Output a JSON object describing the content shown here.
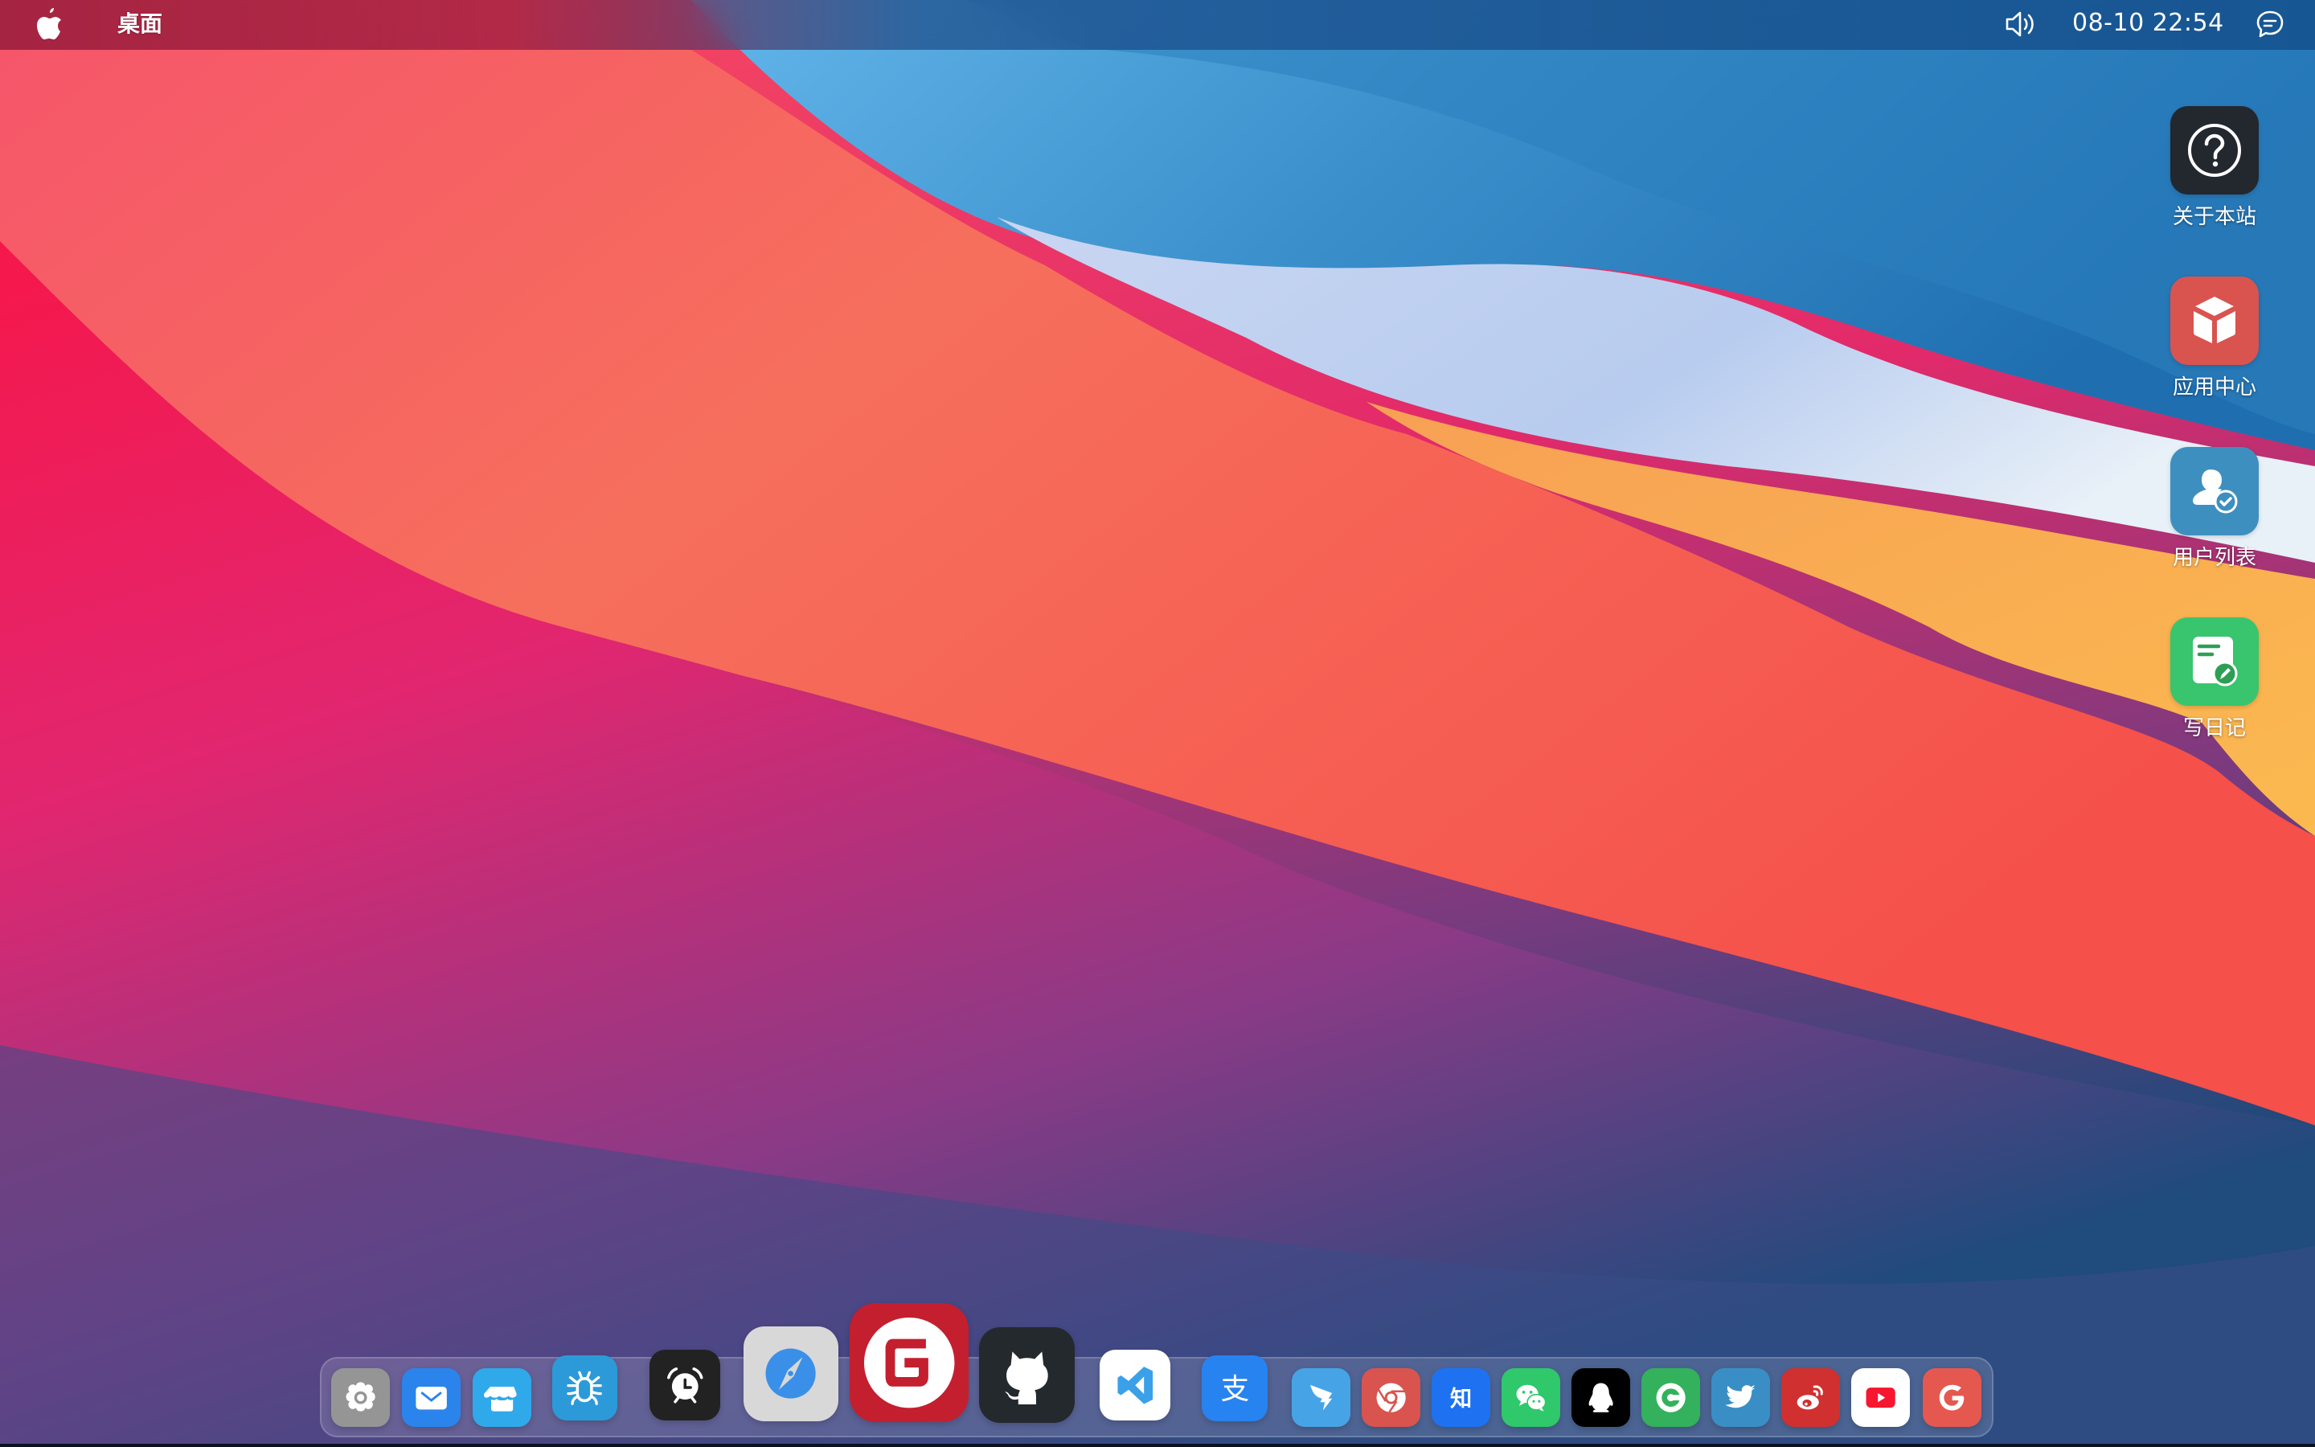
{
  "menubar": {
    "apple_icon": "apple-logo-icon",
    "title": "桌面",
    "volume_icon": "volume-icon",
    "clock": "08-10 22:54",
    "message_icon": "chat-bubble-icon"
  },
  "desktop_icons": [
    {
      "label": "关于本站",
      "icon": "help-circle-icon",
      "color": "#23272e"
    },
    {
      "label": "应用中心",
      "icon": "box-icon",
      "color": "#d9534f"
    },
    {
      "label": "用户列表",
      "icon": "user-check-icon",
      "color": "#3d8fc0"
    },
    {
      "label": "写日记",
      "icon": "note-edit-icon",
      "color": "#38c56d"
    }
  ],
  "dock": {
    "items": [
      {
        "name": "settings",
        "icon": "gear-icon",
        "color": "#959595"
      },
      {
        "name": "mail",
        "icon": "mail-icon",
        "color": "#2b84ec"
      },
      {
        "name": "app-store",
        "icon": "store-icon",
        "color": "#2fa9ea"
      },
      {
        "name": "bug",
        "icon": "bug-icon",
        "color": "#2c9ad8"
      },
      {
        "name": "alarm",
        "icon": "alarm-clock-icon",
        "color": "#222222"
      },
      {
        "name": "safari",
        "icon": "compass-icon",
        "color": "#d8d8d8"
      },
      {
        "name": "gitee",
        "icon": "gitee-icon",
        "color": "#c41f2f"
      },
      {
        "name": "github",
        "icon": "github-icon",
        "color": "#24292e"
      },
      {
        "name": "vscode",
        "icon": "vscode-icon",
        "color": "#ffffff"
      },
      {
        "name": "alipay",
        "icon": "alipay-icon",
        "color": "#2783f0"
      },
      {
        "name": "dingtalk",
        "icon": "dingtalk-icon",
        "color": "#46a4e6"
      },
      {
        "name": "chrome",
        "icon": "chrome-icon",
        "color": "#d9534f"
      },
      {
        "name": "zhihu",
        "icon": "zhihu-icon",
        "color": "#1e72f2",
        "glyph": "知"
      },
      {
        "name": "wechat",
        "icon": "wechat-icon",
        "color": "#2fc86b"
      },
      {
        "name": "qq",
        "icon": "qq-penguin-icon",
        "color": "#000000"
      },
      {
        "name": "copyright",
        "icon": "copyright-c-icon",
        "color": "#33b15c"
      },
      {
        "name": "twitter",
        "icon": "twitter-bird-icon",
        "color": "#3a8ec6"
      },
      {
        "name": "weibo",
        "icon": "weibo-icon",
        "color": "#d0302f"
      },
      {
        "name": "youtube",
        "icon": "youtube-icon",
        "color": "#ffffff"
      },
      {
        "name": "google",
        "icon": "google-g-icon",
        "color": "#e4584f"
      }
    ]
  }
}
